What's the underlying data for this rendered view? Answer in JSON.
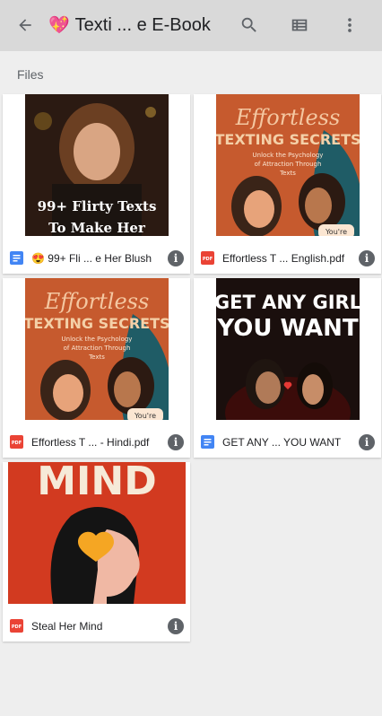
{
  "header": {
    "title_emoji": "💖",
    "title": "Texti ... e E-Book",
    "icons": [
      "back-arrow-icon",
      "search-icon",
      "list-view-icon",
      "more-vert-icon"
    ]
  },
  "section": {
    "label": "Files"
  },
  "files": [
    {
      "name": "😍 99+ Fli ... e Her Blush",
      "type": "doc",
      "thumb_text": [
        "99+ Flirty Texts",
        "To Make Her"
      ]
    },
    {
      "name": "Effortless T ... English.pdf",
      "type": "pdf",
      "thumb_text": [
        "Effortless",
        "TEXTING SECRETS",
        "Unlock the Psychology",
        "of Attraction Through",
        "Texts",
        "You're"
      ]
    },
    {
      "name": "Effortless T ... - Hindi.pdf",
      "type": "pdf",
      "thumb_text": [
        "Effortless",
        "TEXTING SECRETS",
        "Unlock the Psychology",
        "of Attraction Through",
        "Texts",
        "You're"
      ]
    },
    {
      "name": "GET ANY ... YOU WANT",
      "type": "doc",
      "thumb_text": [
        "GET ANY GIRL",
        "YOU WANT"
      ]
    },
    {
      "name": "Steal Her Mind",
      "type": "pdf",
      "thumb_text": [
        "MIND"
      ]
    }
  ],
  "file_type_labels": {
    "pdf": "PDF"
  },
  "info_label": "i"
}
